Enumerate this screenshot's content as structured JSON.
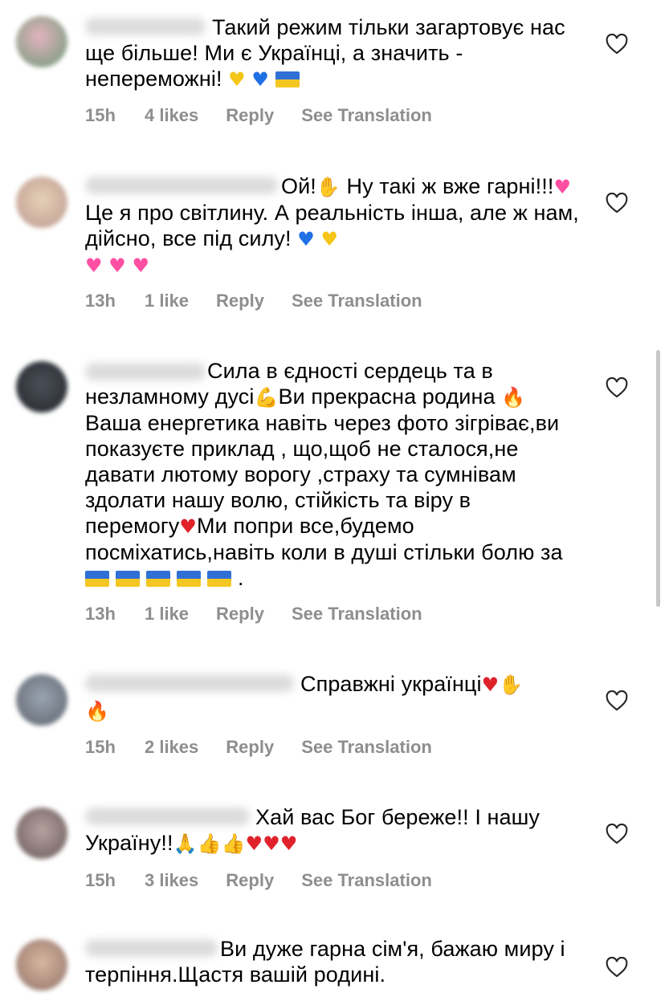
{
  "comments": [
    {
      "text": "Такий режим тільки загартовує нас ще більше! Ми є Українці, а значить - непереможні!",
      "time": "15h",
      "likes": "4 likes",
      "reply": "Reply",
      "translate": "See Translation",
      "avatar_color": "#c9a3a8"
    },
    {
      "text_a": "Ой!",
      "text_b": "Ну такі ж вже гарні!!!",
      "text_c": "Це я про світлину. А реальність інша, але ж нам, дійсно, все під силу!",
      "time": "13h",
      "likes": "1 like",
      "reply": "Reply",
      "translate": "See Translation",
      "avatar_color": "#d9c2a8"
    },
    {
      "text_a": "Сила в єдності сердець та в незламному дусі",
      "text_b": "Ви прекрасна родина",
      "text_c": "Ваша енергетика навіть через фото зігріває,ви показуєте приклад , що,щоб не сталося,не давати лютому ворогу ,страху та сумнівам здолати нашу волю, стійкість та віру в перемогу",
      "text_d": "Ми попри все,будемо посміхатись,навіть коли в душі стільки болю за",
      "text_e": ".",
      "time": "13h",
      "likes": "1 like",
      "reply": "Reply",
      "translate": "See Translation",
      "avatar_color": "#5a5f66"
    },
    {
      "text": "Справжні українці",
      "time": "15h",
      "likes": "2 likes",
      "reply": "Reply",
      "translate": "See Translation",
      "avatar_color": "#8a8f99"
    },
    {
      "text_a": "Хай вас Бог береже!! І  нашу Україну!!",
      "time": "15h",
      "likes": "3 likes",
      "reply": "Reply",
      "translate": "See Translation",
      "avatar_color": "#9a8585"
    },
    {
      "text": "Ви дуже гарна сім'я, бажаю миру і терпіння.Щастя вашій родині.",
      "avatar_color": "#c7a98f"
    }
  ]
}
